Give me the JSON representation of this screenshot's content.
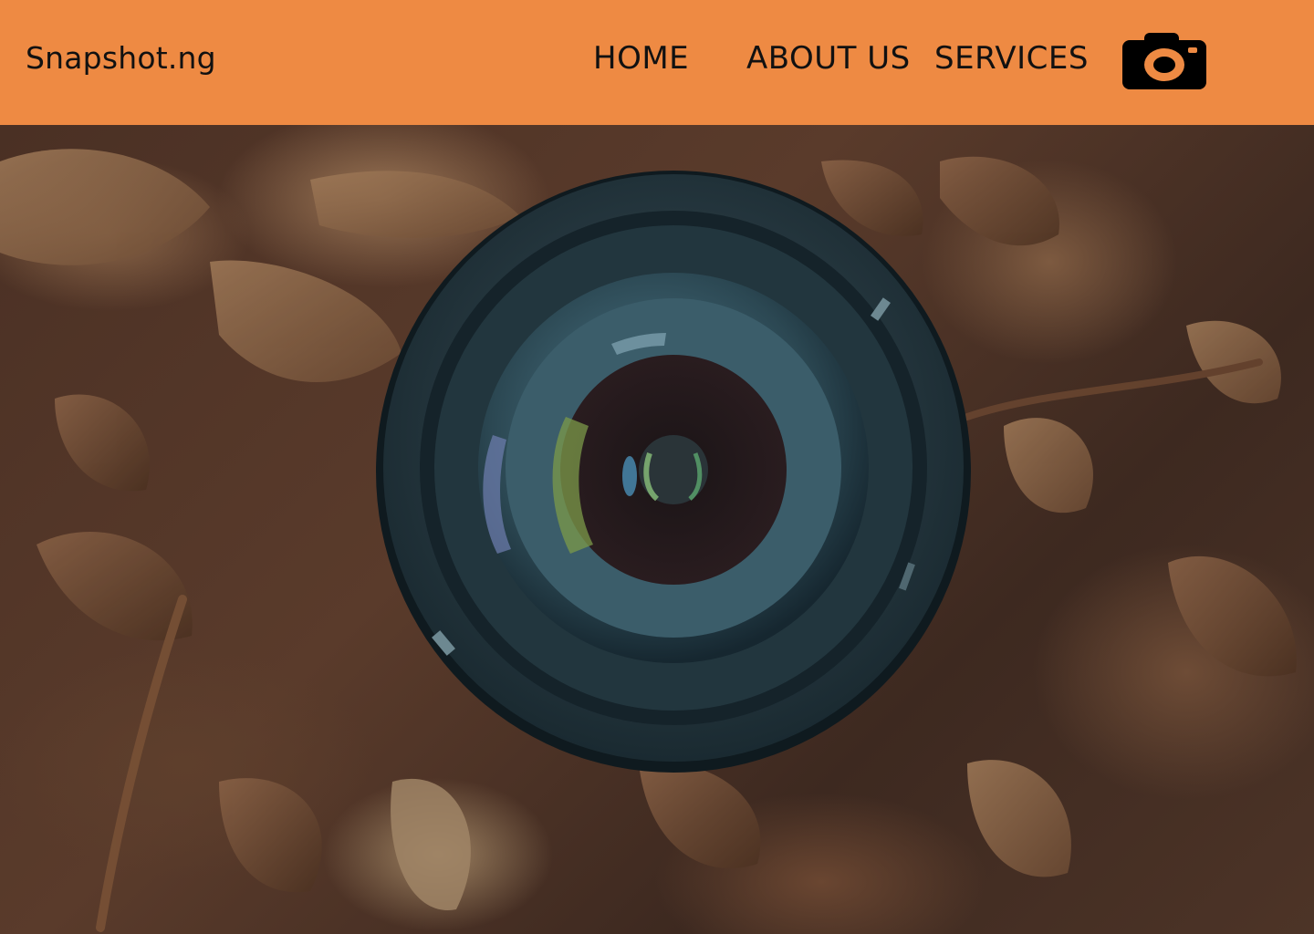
{
  "header": {
    "brand": "Snapshot.ng",
    "nav": {
      "home": "HOME",
      "about": "ABOUT US",
      "services": "SERVICES"
    },
    "icon": "camera-icon",
    "background_color": "#ee8a43",
    "text_color": "#111111"
  },
  "hero": {
    "image_alt": "camera-lens-on-dry-leaves"
  }
}
